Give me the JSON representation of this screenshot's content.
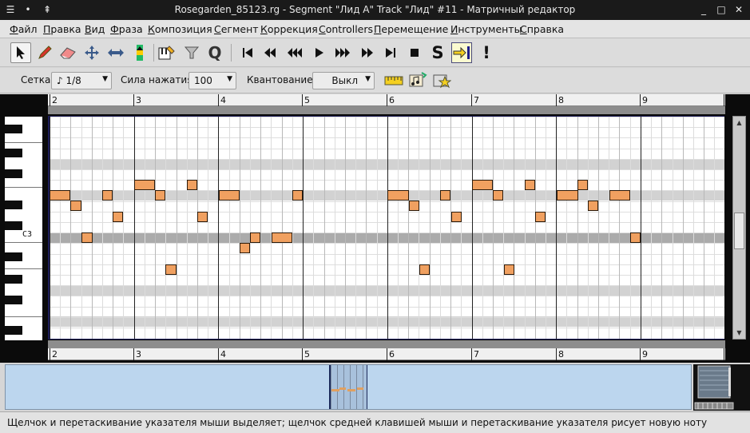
{
  "window": {
    "title": "Rosegarden_85123.rg - Segment \"Лид А\" Track \"Лид\" #11 - Матричный редактор",
    "controls": [
      "☰",
      "•",
      "⇞",
      "_",
      "□",
      "✕"
    ]
  },
  "menu": [
    "Файл",
    "Правка",
    "Вид",
    "Фраза",
    "Композиция",
    "Сегмент",
    "Коррекция",
    "Controllers",
    "Перемещение",
    "Инструменты",
    "Справка"
  ],
  "toolbar2": {
    "grid_label": "Сетка:",
    "grid_value": "♪ 1/8",
    "velocity_label": "Сила нажатия:",
    "velocity_value": "100",
    "quantize_label": "Квантование:",
    "quantize_value": "Выкл"
  },
  "ruler": {
    "bars": [
      "2",
      "3",
      "4",
      "5",
      "6",
      "7",
      "8",
      "9"
    ]
  },
  "piano": {
    "c3_label": "C3"
  },
  "status": {
    "message": "Щелчок и перетаскивание указателя мыши выделяет; щелчок средней клавишей мыши и перетаскивание указателя рисует новую ноту"
  }
}
